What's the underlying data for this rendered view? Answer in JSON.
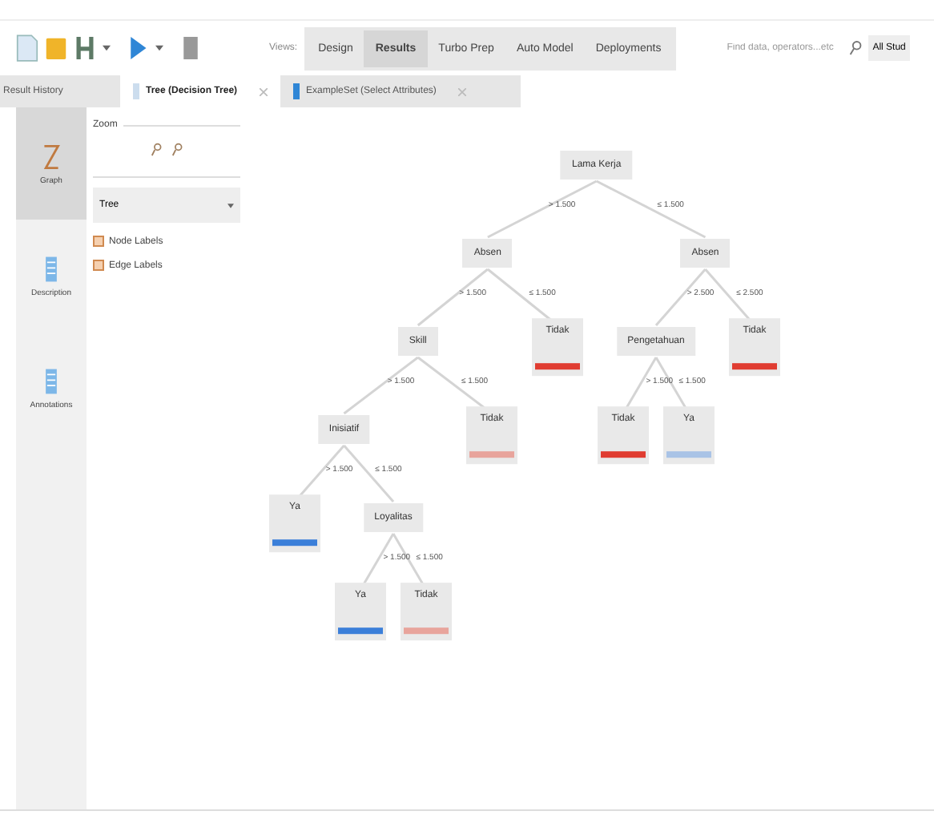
{
  "toolbar": {
    "views_label": "Views:",
    "views": [
      {
        "label": "Design",
        "selected": false
      },
      {
        "label": "Results",
        "selected": true
      },
      {
        "label": "Turbo Prep",
        "selected": false
      },
      {
        "label": "Auto Model",
        "selected": false
      },
      {
        "label": "Deployments",
        "selected": false
      }
    ],
    "search": {
      "placeholder": "Find data, operators...etc"
    },
    "scope": "All Stud"
  },
  "tabs": [
    {
      "label": "Result History",
      "selected": false
    },
    {
      "label": "Tree (Decision Tree)",
      "selected": true
    },
    {
      "label": "ExampleSet (Select Attributes)",
      "selected": false
    }
  ],
  "sidebar": [
    {
      "label": "Graph",
      "selected": true
    },
    {
      "label": "Description",
      "selected": false
    },
    {
      "label": "Annotations",
      "selected": false
    }
  ],
  "panel": {
    "zoom_label": "Zoom",
    "mode": "Tree",
    "options": [
      {
        "label": "Node Labels",
        "checked": true
      },
      {
        "label": "Edge Labels",
        "checked": true
      }
    ]
  },
  "tree": {
    "label": "Lama Kerja",
    "children": [
      {
        "edge": "> 1.500",
        "label": "Absen",
        "children": [
          {
            "edge": "> 1.500",
            "label": "Skill",
            "children": [
              {
                "edge": "> 1.500",
                "label": "Inisiatif",
                "children": [
                  {
                    "edge": "> 1.500",
                    "label": "Ya",
                    "color": "#3b7fd9"
                  },
                  {
                    "edge": "≤ 1.500",
                    "label": "Loyalitas",
                    "children": [
                      {
                        "edge": "> 1.500",
                        "label": "Ya",
                        "color": "#3b7fd9"
                      },
                      {
                        "edge": "≤ 1.500",
                        "label": "Tidak",
                        "color": "#e8a49c"
                      }
                    ]
                  }
                ]
              },
              {
                "edge": "≤ 1.500",
                "label": "Tidak",
                "color": "#e8a49c"
              }
            ]
          },
          {
            "edge": "≤ 1.500",
            "label": "Tidak",
            "color": "#e03c31"
          }
        ]
      },
      {
        "edge": "≤ 1.500",
        "label": "Absen",
        "children": [
          {
            "edge": "> 2.500",
            "label": "Pengetahuan",
            "children": [
              {
                "edge": "> 1.500",
                "label": "Tidak",
                "color": "#e03c31"
              },
              {
                "edge": "≤ 1.500",
                "label": "Ya",
                "color": "#a9c3e6"
              }
            ]
          },
          {
            "edge": "≤ 2.500",
            "label": "Tidak",
            "color": "#e03c31"
          }
        ]
      }
    ]
  }
}
